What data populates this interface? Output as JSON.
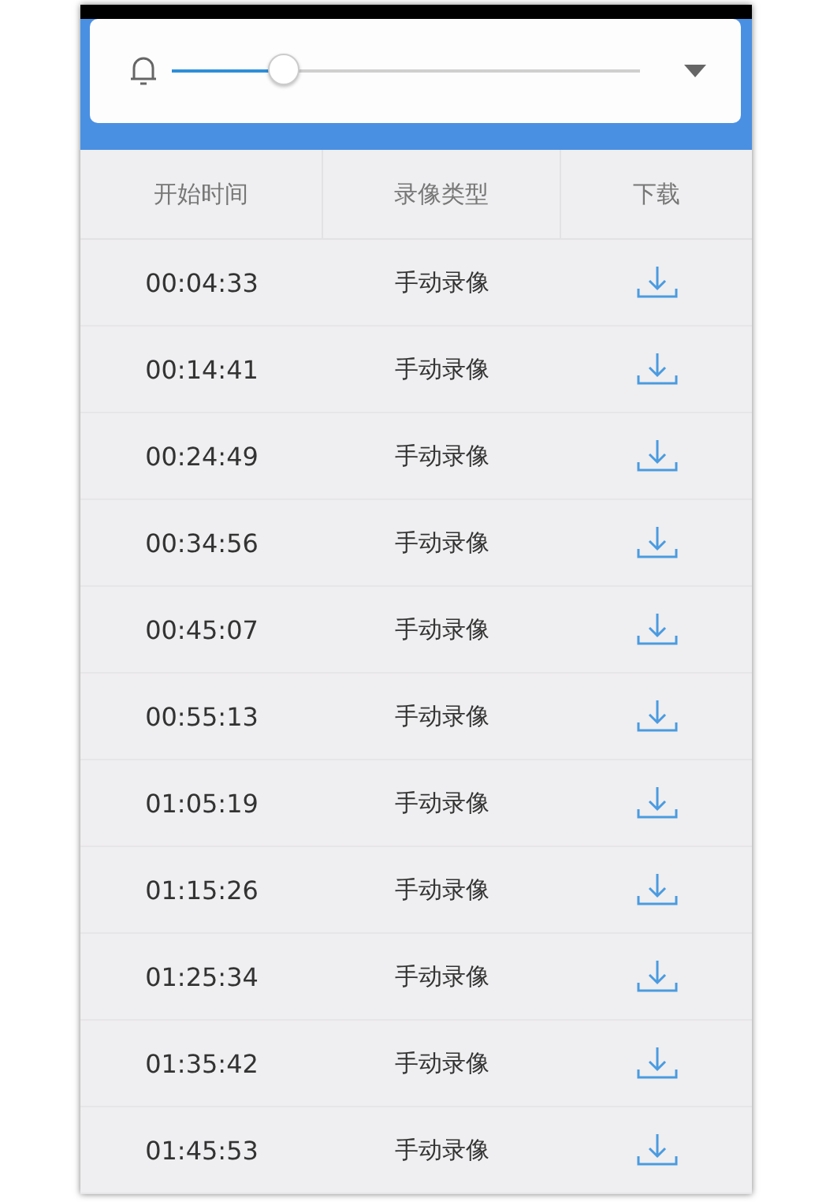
{
  "volume": {
    "level": 0.22
  },
  "columns": [
    "开始时间",
    "录像类型",
    "下载"
  ],
  "rows": [
    {
      "time": "00:04:33",
      "type": "手动录像"
    },
    {
      "time": "00:14:41",
      "type": "手动录像"
    },
    {
      "time": "00:24:49",
      "type": "手动录像"
    },
    {
      "time": "00:34:56",
      "type": "手动录像"
    },
    {
      "time": "00:45:07",
      "type": "手动录像"
    },
    {
      "time": "00:55:13",
      "type": "手动录像"
    },
    {
      "time": "01:05:19",
      "type": "手动录像"
    },
    {
      "time": "01:15:26",
      "type": "手动录像"
    },
    {
      "time": "01:25:34",
      "type": "手动录像"
    },
    {
      "time": "01:35:42",
      "type": "手动录像"
    },
    {
      "time": "01:45:53",
      "type": "手动录像"
    }
  ]
}
